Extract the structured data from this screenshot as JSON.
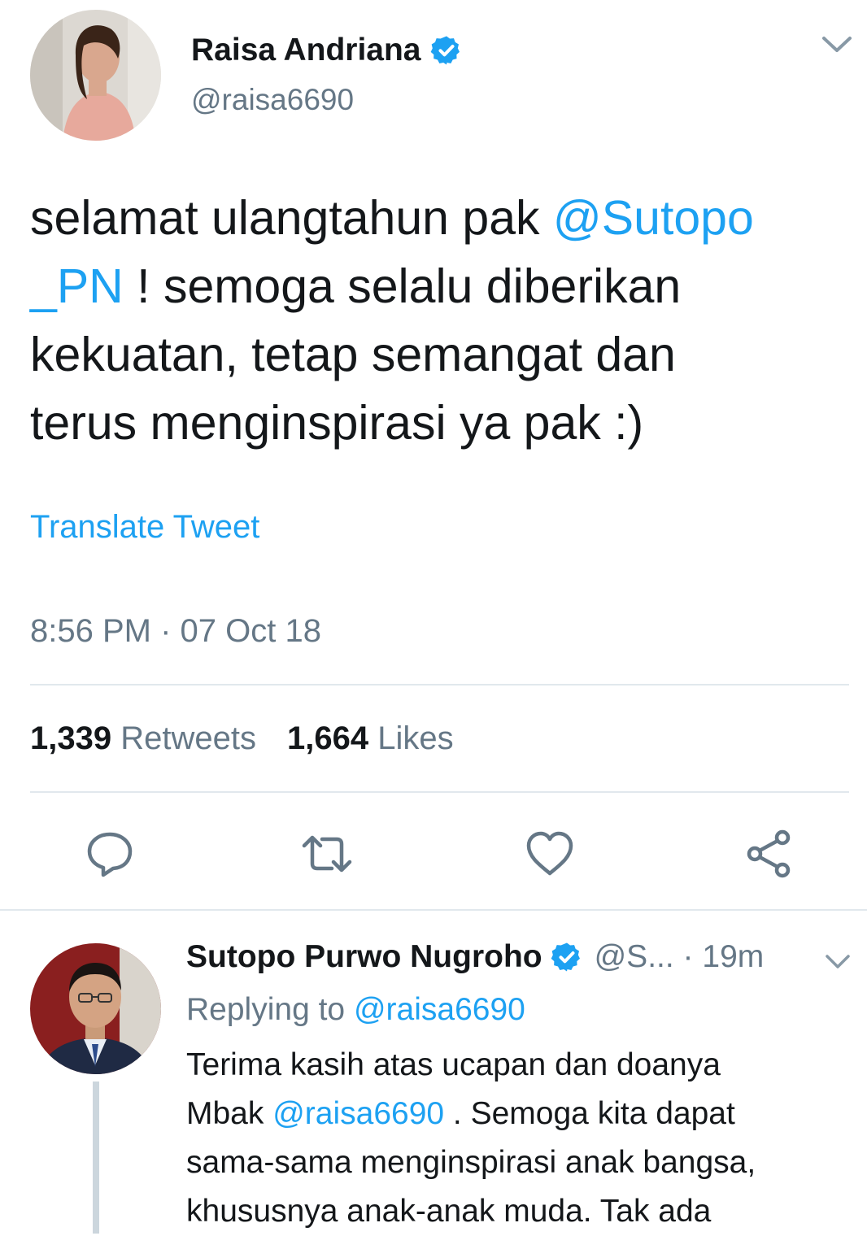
{
  "main_tweet": {
    "author_name": "Raisa Andriana",
    "author_handle": "@raisa6690",
    "text_part1": "selamat ulangtahun pak ",
    "mention_part1": "@Sutopo",
    "mention_part2": "_PN",
    "text_part2": " ! semoga selalu diberikan\nkekuatan, tetap semangat dan\nterus menginspirasi ya pak :)",
    "translate_label": "Translate Tweet",
    "timestamp": "8:56 PM · 07 Oct 18",
    "retweet_count": "1,339",
    "retweet_label": "Retweets",
    "like_count": "1,664",
    "like_label": "Likes"
  },
  "reply": {
    "author_name": "Sutopo Purwo Nugroho",
    "author_handle_truncated": "@S...",
    "time_separator": " · ",
    "relative_time": "19m",
    "replying_label": "Replying to ",
    "replying_handle": "@raisa6690",
    "text_part1": "Terima kasih atas ucapan dan doanya\nMbak ",
    "mention": "@raisa6690",
    "text_part2": " . Semoga kita dapat\nsama-sama menginspirasi anak bangsa,\nkhususnya anak-anak muda. Tak ada"
  },
  "icons": {
    "verified": "verified-badge-icon",
    "caret": "chevron-down-icon",
    "reply": "reply-icon",
    "retweet": "retweet-icon",
    "like": "heart-icon",
    "share": "share-icon"
  },
  "colors": {
    "accent": "#1da1f2",
    "text": "#14171a",
    "muted": "#657786",
    "divider": "#e1e8ed"
  }
}
